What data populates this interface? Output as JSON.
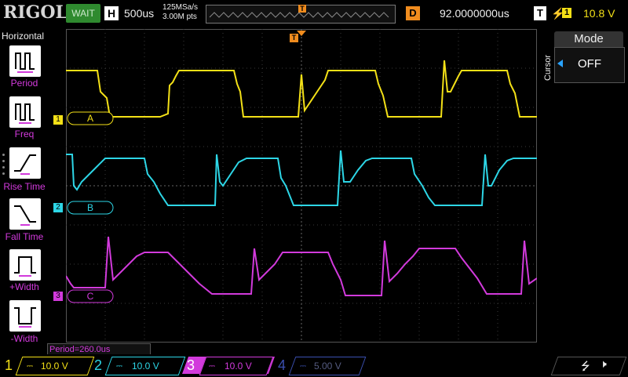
{
  "header": {
    "brand": "RIGOL",
    "run_status": "WAIT",
    "timebase_label": "H",
    "timebase": "500us",
    "sample_rate": "125MSa/s",
    "memory_depth": "3.00M pts",
    "trigger_pos_marker": "T",
    "delay_label": "D",
    "delay": "92.0000000us",
    "trigger_label": "T",
    "trigger_source": "1",
    "trigger_level": "10.8 V"
  },
  "left_panel": {
    "title": "Horizontal",
    "items": [
      {
        "label": "Period"
      },
      {
        "label": "Freq"
      },
      {
        "label": "Rise Time"
      },
      {
        "label": "Fall Time"
      },
      {
        "label": "+Width"
      },
      {
        "label": "-Width"
      }
    ]
  },
  "right_panel": {
    "side_label": "Cursor",
    "mode_title": "Mode",
    "mode_value": "OFF"
  },
  "traces": {
    "a_label": "A",
    "b_label": "B",
    "c_label": "C",
    "marker_1": "1",
    "marker_2": "2",
    "marker_3": "3",
    "trigger_marker": "T"
  },
  "measurement": {
    "text": "Period=260.0us"
  },
  "channels": [
    {
      "num": "1",
      "scale": "10.0 V",
      "color": "#f3e017"
    },
    {
      "num": "2",
      "scale": "10.0 V",
      "color": "#2dd6e6"
    },
    {
      "num": "3",
      "scale": "10.0 V",
      "color": "#d23adc"
    },
    {
      "num": "4",
      "scale": "5.00 V",
      "color": "#3a4fb0"
    }
  ],
  "colors": {
    "ch1": "#f3e017",
    "ch2": "#2dd6e6",
    "ch3": "#d23adc",
    "ch4": "#3a4fb0",
    "trigger": "#f08c1e",
    "run_status_bg": "#2f8a2f"
  },
  "icons": [
    "usb-icon",
    "speaker-icon"
  ]
}
